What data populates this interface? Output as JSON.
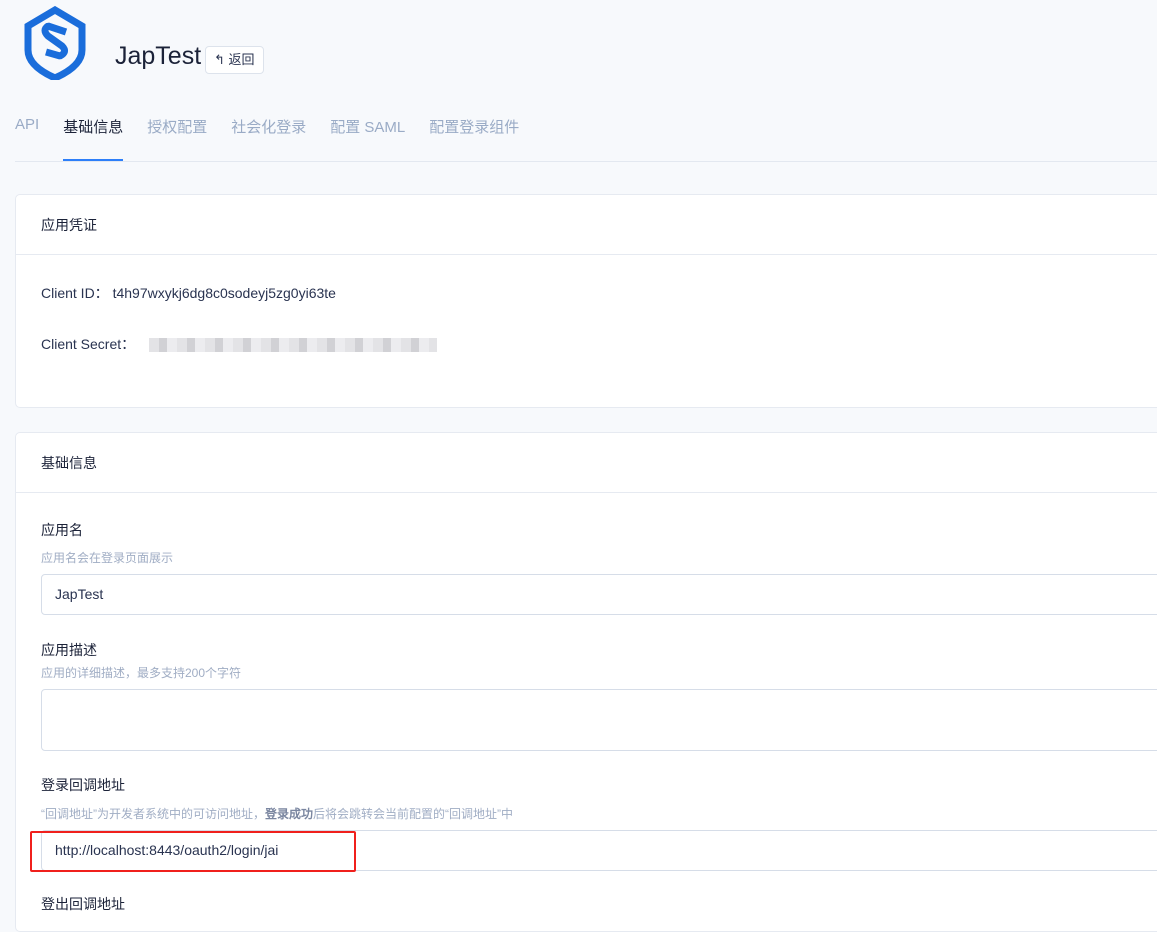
{
  "header": {
    "app_name": "JapTest",
    "back_label": "↰ 返回"
  },
  "tabs": [
    {
      "label": "API"
    },
    {
      "label": "基础信息"
    },
    {
      "label": "授权配置"
    },
    {
      "label": "社会化登录"
    },
    {
      "label": "配置 SAML"
    },
    {
      "label": "配置登录组件"
    }
  ],
  "credentials": {
    "title": "应用凭证",
    "client_id_label": "Client ID：",
    "client_id": "t4h97wxykj6dg8c0sodeyj5zg0yi63te",
    "client_secret_label": "Client Secret："
  },
  "basic": {
    "title": "基础信息",
    "app_name_label": "应用名",
    "app_name_hint": "应用名会在登录页面展示",
    "app_name_value": "JapTest",
    "desc_label": "应用描述",
    "desc_hint": "应用的详细描述，最多支持200个字符",
    "desc_value": "",
    "callback_label": "登录回调地址",
    "callback_hint_a": "“回调地址”为开发者系统中的可访问地址，",
    "callback_hint_bold": "登录成功",
    "callback_hint_b": "后将会跳转会当前配置的“回调地址”中",
    "callback_value": "http://localhost:8443/oauth2/login/jai",
    "logout_label": "登出回调地址"
  },
  "colors": {
    "accent": "#2d7ff9",
    "highlight": "#f0201c"
  }
}
